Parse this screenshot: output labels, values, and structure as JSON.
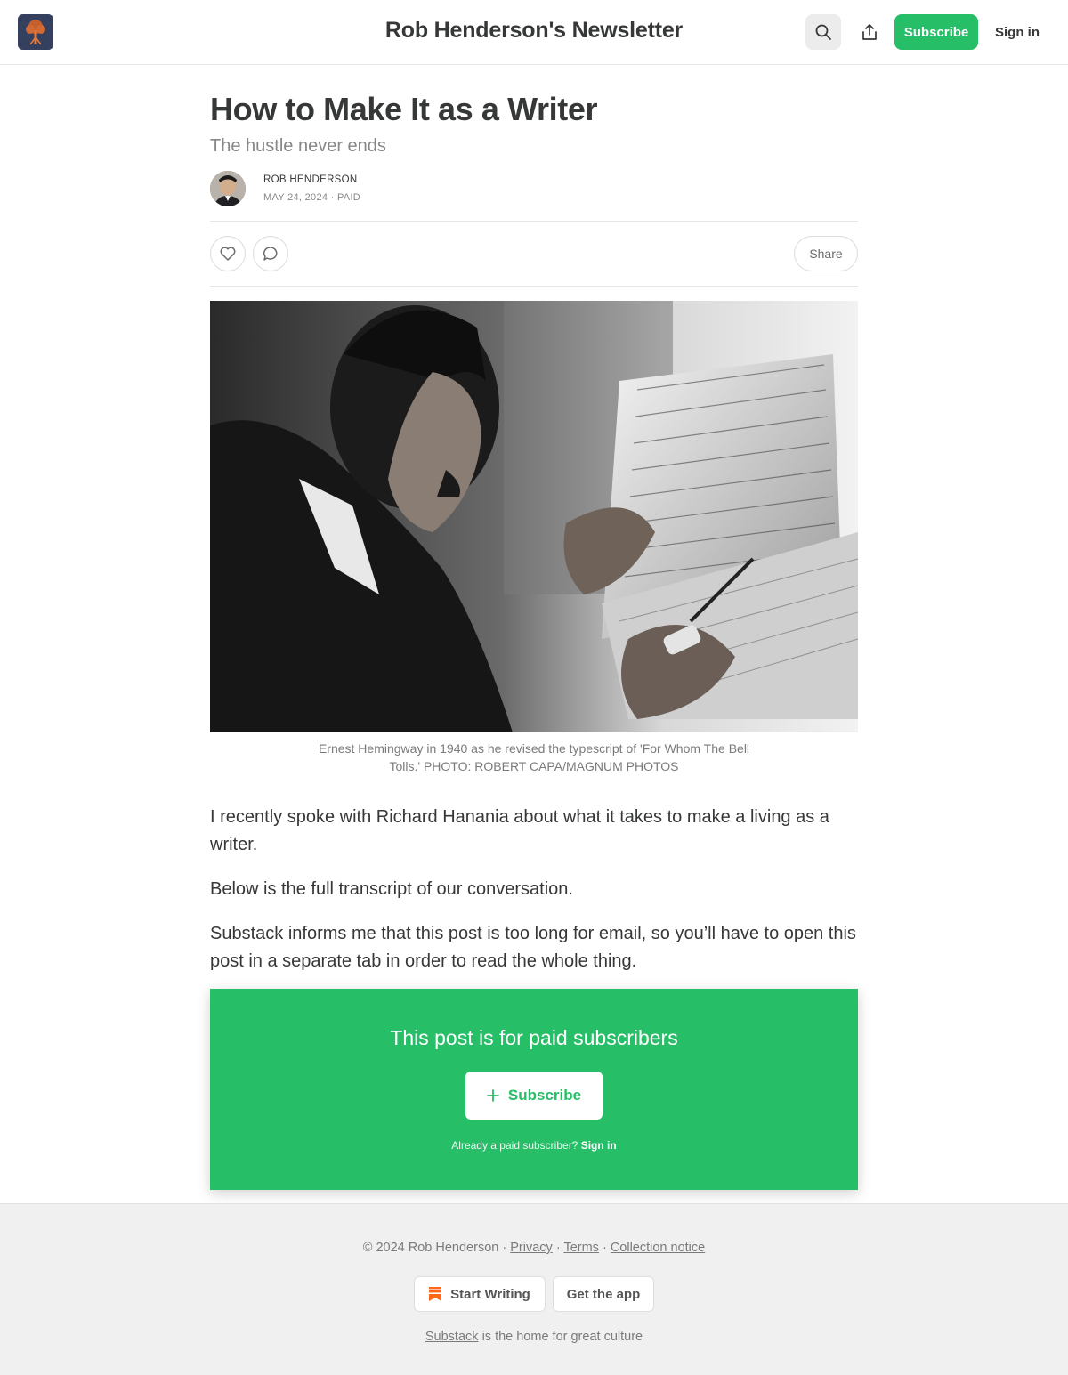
{
  "header": {
    "publication_title": "Rob Henderson's Newsletter",
    "subscribe_label": "Subscribe",
    "signin_label": "Sign in",
    "icons": [
      "logo-tree-icon",
      "search-icon",
      "share-icon"
    ]
  },
  "post": {
    "title": "How to Make It as a Writer",
    "subtitle": "The hustle never ends",
    "author": "ROB HENDERSON",
    "date": "MAY 24, 2024",
    "access": "PAID",
    "separator": "·",
    "share_label": "Share",
    "image_caption": "Ernest Hemingway in 1940 as he revised the typescript of 'For Whom The Bell Tolls.' PHOTO: ROBERT CAPA/MAGNUM PHOTOS",
    "paragraphs": [
      "I recently spoke with Richard Hanania about what it takes to make a living as a writer.",
      "Below is the full transcript of our conversation.",
      "Substack informs me that this post is too long for email, so you’ll have to open this post in a separate tab in order to read the whole thing."
    ]
  },
  "paywall": {
    "title": "This post is for paid subscribers",
    "subscribe_label": "Subscribe",
    "note": "Already a paid subscriber?",
    "signin_label": "Sign in"
  },
  "footer": {
    "copyright": "© 2024 Rob Henderson",
    "dot": "·",
    "privacy": "Privacy",
    "terms": "Terms",
    "collection_notice": "Collection notice",
    "start_writing": "Start Writing",
    "get_app": "Get the app",
    "substack": "Substack",
    "tagline": "is the home for great culture"
  },
  "colors": {
    "accent_green": "#26be67",
    "text": "#363737",
    "muted": "#868787",
    "footer_bg": "#f0f0f0"
  }
}
